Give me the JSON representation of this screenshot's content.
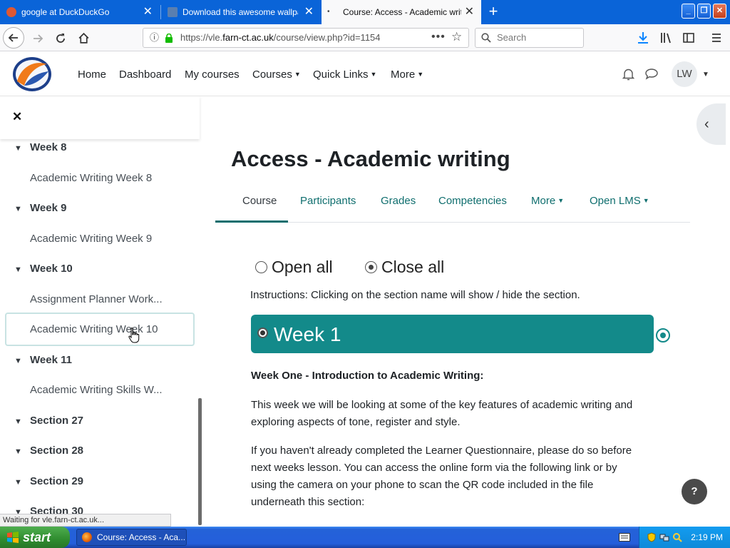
{
  "browser": {
    "tabs": [
      {
        "title": "google at DuckDuckGo",
        "favicon_color": "#de5833"
      },
      {
        "title": "Download this awesome wallpaper",
        "favicon_color": "#5a7fb0"
      },
      {
        "title": "Course: Access - Academic writing",
        "favicon_color": "#444444"
      }
    ],
    "new_tab": "+",
    "url_scheme": "https://vle.",
    "url_host": "farn-ct.ac.uk",
    "url_path": "/course/view.php?id=1154",
    "search_placeholder": "Search"
  },
  "header": {
    "nav": [
      {
        "label": "Home",
        "dropdown": false
      },
      {
        "label": "Dashboard",
        "dropdown": false
      },
      {
        "label": "My courses",
        "dropdown": false
      },
      {
        "label": "Courses",
        "dropdown": true
      },
      {
        "label": "Quick Links",
        "dropdown": true
      },
      {
        "label": "More",
        "dropdown": true
      }
    ],
    "avatar_initials": "LW"
  },
  "drawer": {
    "close": "✕",
    "entries": [
      {
        "type": "section",
        "label": "Week 8"
      },
      {
        "type": "item",
        "label": "Academic Writing Week 8"
      },
      {
        "type": "section",
        "label": "Week 9"
      },
      {
        "type": "item",
        "label": "Academic Writing Week 9"
      },
      {
        "type": "section",
        "label": "Week 10"
      },
      {
        "type": "item",
        "label": "Assignment Planner Work..."
      },
      {
        "type": "item",
        "label": "Academic Writing Week 10",
        "active": true
      },
      {
        "type": "section",
        "label": "Week 11"
      },
      {
        "type": "item",
        "label": "Academic Writing Skills W..."
      },
      {
        "type": "section",
        "label": "Section 27"
      },
      {
        "type": "section",
        "label": "Section 28"
      },
      {
        "type": "section",
        "label": "Section 29"
      },
      {
        "type": "section",
        "label": "Section 30"
      }
    ]
  },
  "main": {
    "title": "Access - Academic writing",
    "secondary_nav": [
      {
        "label": "Course",
        "active": true,
        "dropdown": false
      },
      {
        "label": "Participants",
        "dropdown": false
      },
      {
        "label": "Grades",
        "dropdown": false
      },
      {
        "label": "Competencies",
        "dropdown": false
      },
      {
        "label": "More",
        "dropdown": true
      },
      {
        "label": "Open LMS",
        "dropdown": true
      }
    ],
    "open_all": "Open all",
    "close_all": "Close all",
    "instructions": "Instructions: Clicking on the section name will show / hide the section.",
    "week_title": "Week 1",
    "week_heading": "Week One - Introduction to Academic Writing:",
    "paragraphs": [
      "This week we will be looking at some of the key features of academic writing and exploring aspects of tone, register and style.",
      "If you haven't already completed the Learner Questionnaire, please do so before next weeks lesson. You can access the online form via the following link or by using the camera on your phone to scan the QR code included in the file underneath this section:"
    ],
    "help": "?"
  },
  "status_text": "Waiting for vle.farn-ct.ac.uk...",
  "taskbar": {
    "start_label": "start",
    "task_label": "Course: Access - Aca...",
    "clock": "2:19 PM"
  },
  "colors": {
    "accent": "#138a8a",
    "link": "#0f6e6e",
    "firefox_blue": "#0a64d8"
  }
}
